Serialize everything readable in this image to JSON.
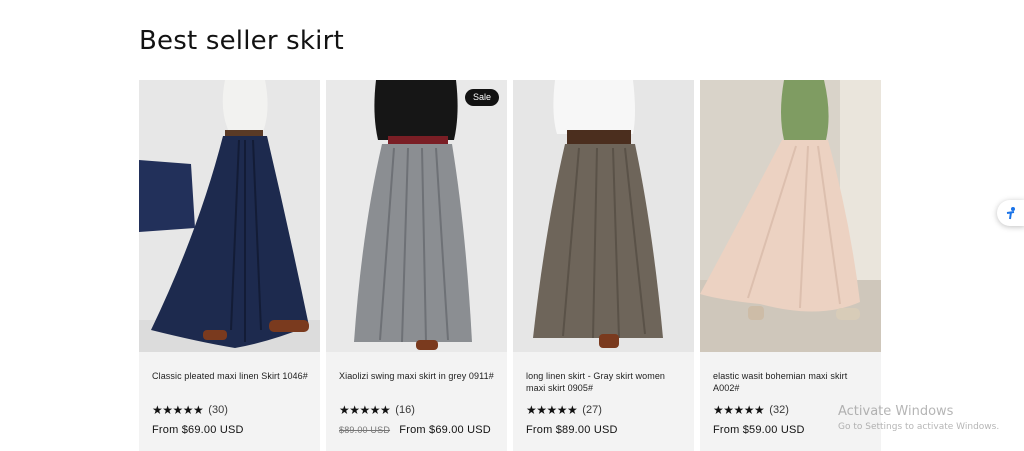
{
  "section": {
    "title": "Best seller skirt"
  },
  "products": [
    {
      "title": "Classic pleated maxi linen Skirt 1046#",
      "stars": "★★★★★",
      "rating_count": "(30)",
      "compare_price": "",
      "price": "From $69.00 USD",
      "badge": "",
      "skirt_color": "#1d2a4e",
      "top_color": "#f2f2f0",
      "bg_color": "#e7e7e7"
    },
    {
      "title": "Xiaolizi swing maxi skirt in grey 0911#",
      "stars": "★★★★★",
      "rating_count": "(16)",
      "compare_price": "$89.00 USD",
      "price": "From $69.00 USD",
      "badge": "Sale",
      "skirt_color": "#8b8e92",
      "top_color": "#161616",
      "bg_color": "#e9e9e9"
    },
    {
      "title": "long linen skirt - Gray skirt women maxi skirt 0905#",
      "stars": "★★★★★",
      "rating_count": "(27)",
      "compare_price": "",
      "price": "From $89.00 USD",
      "badge": "",
      "skirt_color": "#6e655a",
      "top_color": "#f7f7f7",
      "bg_color": "#e6e6e6"
    },
    {
      "title": "elastic wasit bohemian maxi skirt A002#",
      "stars": "★★★★★",
      "rating_count": "(32)",
      "compare_price": "",
      "price": "From $59.00 USD",
      "badge": "",
      "skirt_color": "#ecd2c2",
      "top_color": "#7f9c62",
      "bg_color": "#d9d3c9"
    }
  ],
  "watermark": {
    "title": "Activate Windows",
    "subtitle": "Go to Settings to activate Windows."
  },
  "widget": {
    "icon": "accessibility-icon"
  }
}
